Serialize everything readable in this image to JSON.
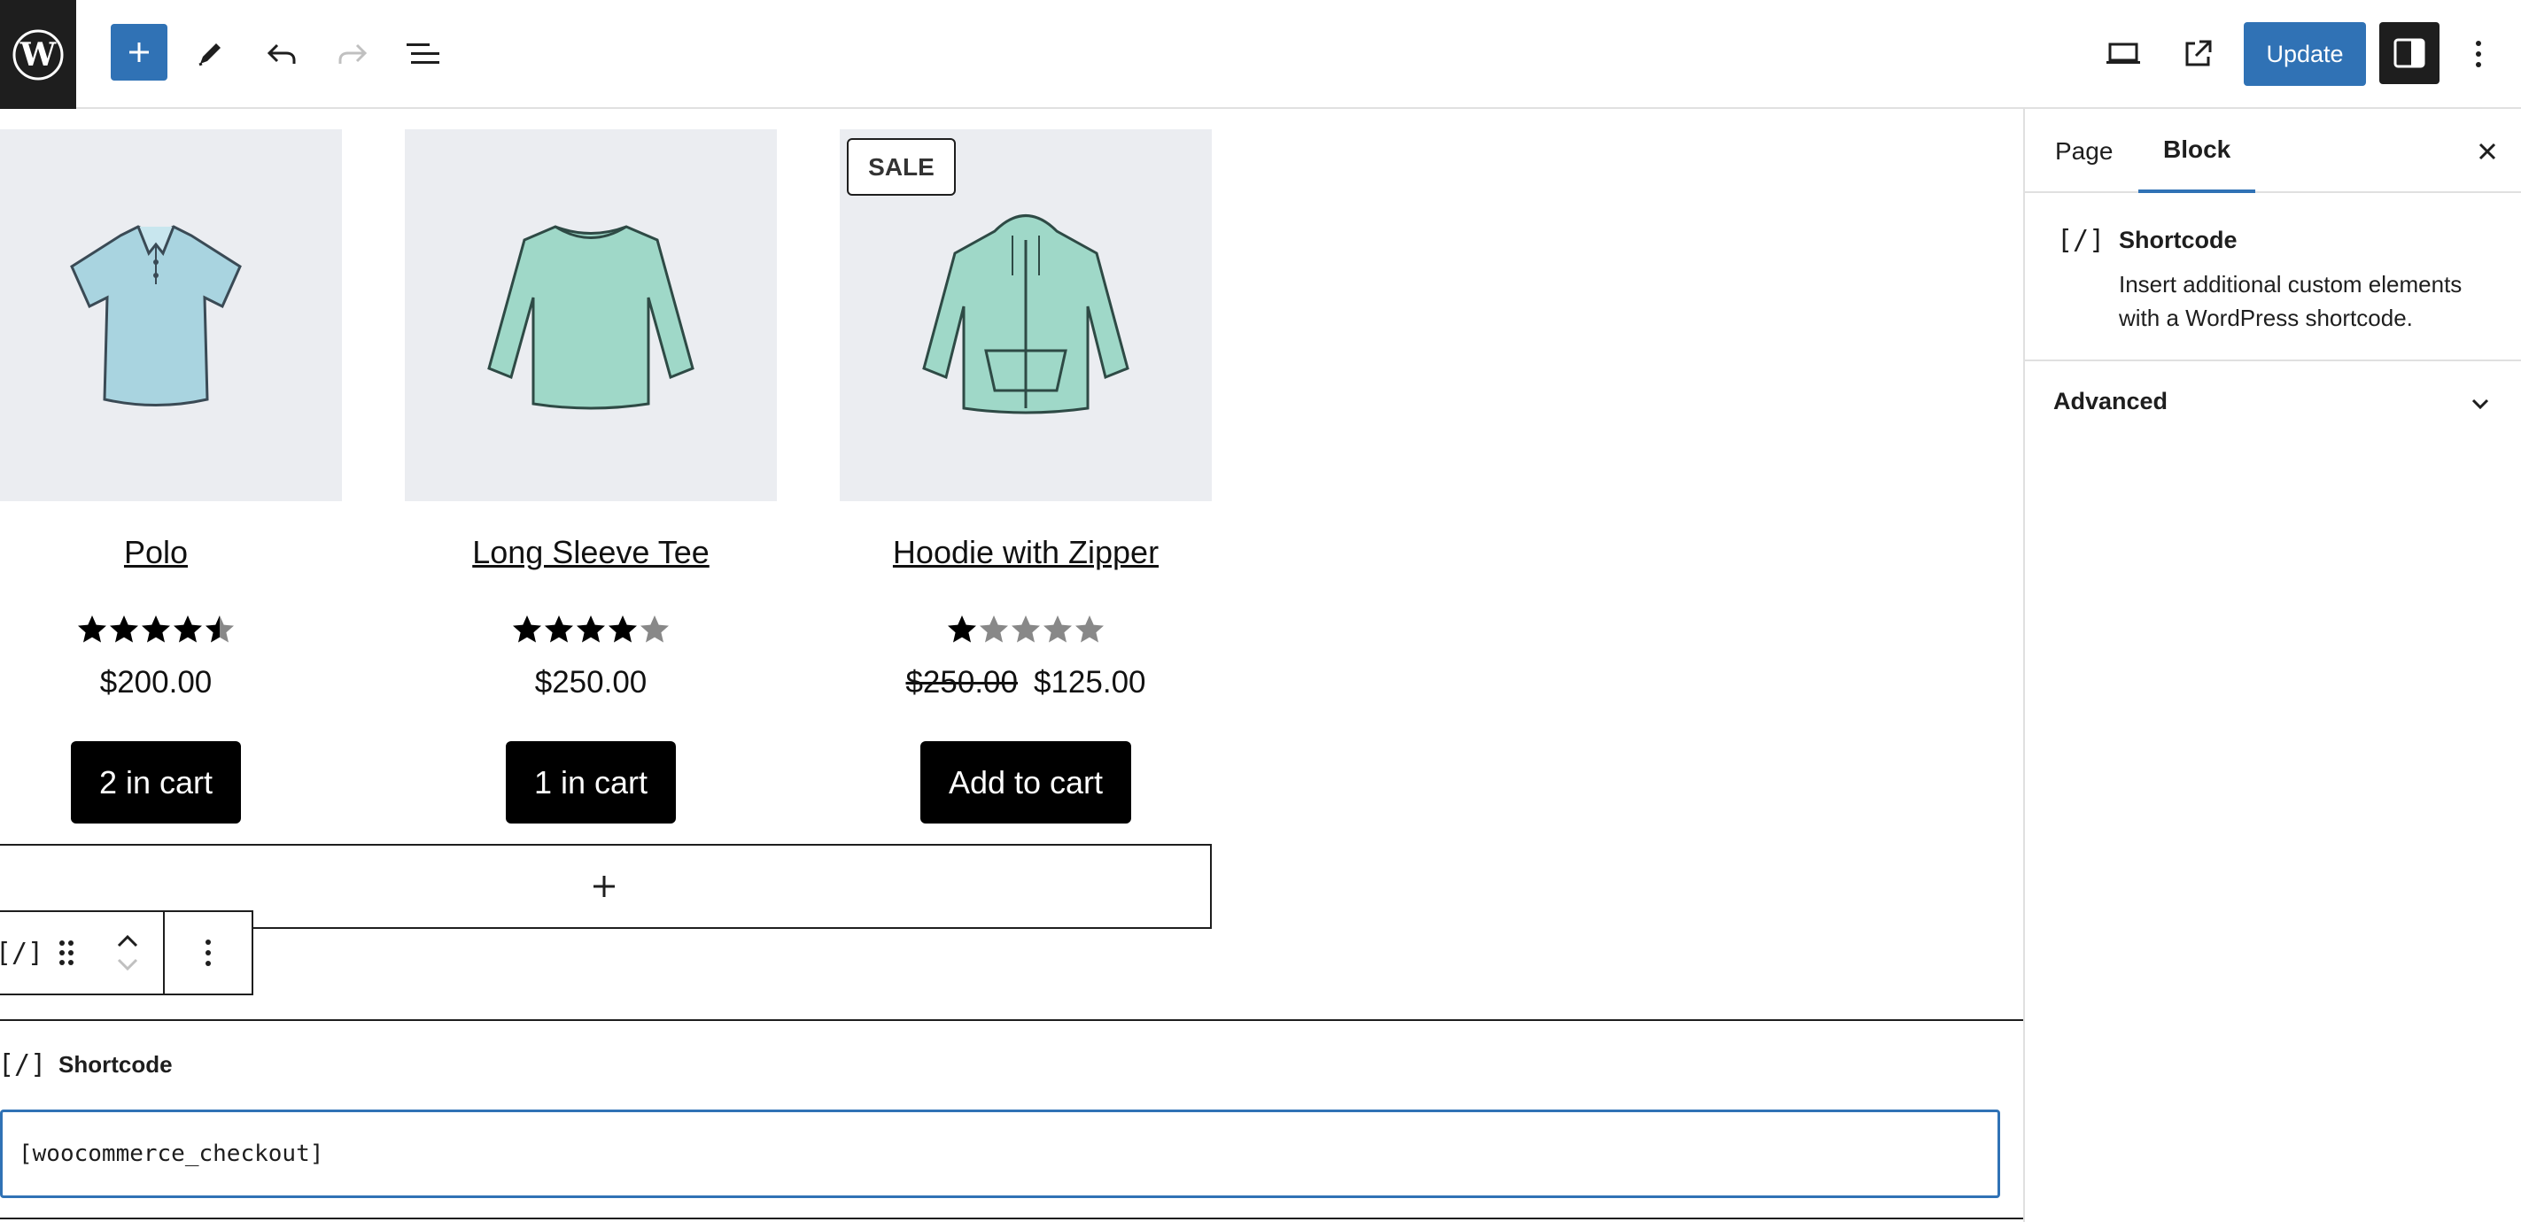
{
  "toolbar": {
    "update_label": "Update",
    "icons": [
      "wordpress-logo",
      "add-block-icon",
      "edit-tools-icon",
      "undo-icon",
      "redo-icon",
      "document-overview-icon",
      "desktop-preview-icon",
      "external-view-icon",
      "settings-icon",
      "options-icon"
    ]
  },
  "products": [
    {
      "title": "Polo",
      "rating": 4.5,
      "price": "$200.00",
      "old_price": "",
      "button": "2 in cart",
      "sale": ""
    },
    {
      "title": "Long Sleeve Tee",
      "rating": 4,
      "price": "$250.00",
      "old_price": "",
      "button": "1 in cart",
      "sale": ""
    },
    {
      "title": "Hoodie with Zipper",
      "rating": 1,
      "price": "$125.00",
      "old_price": "$250.00",
      "button": "Add to cart",
      "sale": "SALE"
    }
  ],
  "block_toolbar": {
    "icon_text": "[/]"
  },
  "shortcode_block": {
    "icon_text": "[/]",
    "label": "Shortcode",
    "value": "[woocommerce_checkout]"
  },
  "sidebar": {
    "tabs": [
      {
        "label": "Page"
      },
      {
        "label": "Block"
      }
    ],
    "block_card": {
      "icon_text": "[/]",
      "title": "Shortcode",
      "description": "Insert additional custom elements with a WordPress shortcode."
    },
    "advanced_label": "Advanced"
  },
  "colors": {
    "accent": "#3072b5",
    "dark": "#1e1e1e",
    "image_bg": "#ebedf1",
    "shirt": "#a8d9d4"
  }
}
